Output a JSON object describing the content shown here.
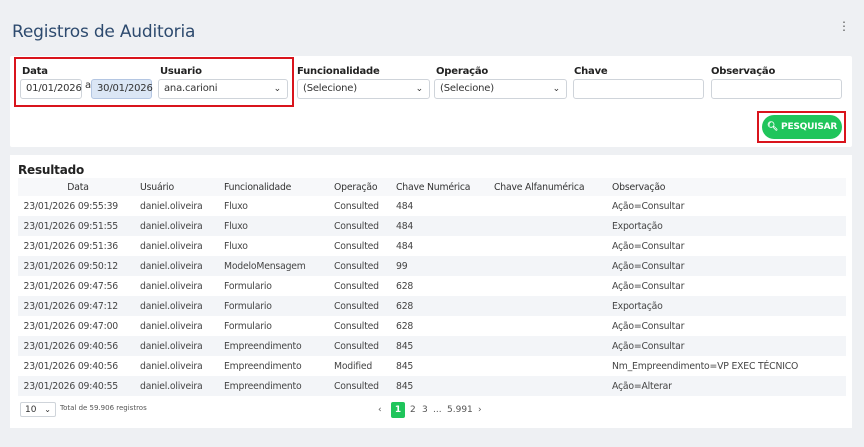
{
  "page": {
    "title": "Registros de Auditoria",
    "menu_icon": "kebab-icon"
  },
  "filters": {
    "date_label": "Data",
    "date_from": "01/01/2026",
    "date_sep": "a",
    "date_to": "30/01/2026",
    "user_label": "Usuario",
    "user_value": "ana.carioni",
    "func_label": "Funcionalidade",
    "func_value": "(Selecione)",
    "op_label": "Operação",
    "op_value": "(Selecione)",
    "key_label": "Chave",
    "key_value": "",
    "obs_label": "Observação",
    "obs_value": "",
    "search_label": "PESQUISAR"
  },
  "results": {
    "title": "Resultado",
    "columns": [
      "Data",
      "Usuário",
      "Funcionalidade",
      "Operação",
      "Chave Numérica",
      "Chave Alfanumérica",
      "Observação"
    ],
    "rows": [
      [
        "23/01/2026 09:55:39",
        "daniel.oliveira",
        "Fluxo",
        "Consulted",
        "484",
        "",
        "Ação=Consultar"
      ],
      [
        "23/01/2026 09:51:55",
        "daniel.oliveira",
        "Fluxo",
        "Consulted",
        "484",
        "",
        "Exportação"
      ],
      [
        "23/01/2026 09:51:36",
        "daniel.oliveira",
        "Fluxo",
        "Consulted",
        "484",
        "",
        "Ação=Consultar"
      ],
      [
        "23/01/2026 09:50:12",
        "daniel.oliveira",
        "ModeloMensagem",
        "Consulted",
        "99",
        "",
        "Ação=Consultar"
      ],
      [
        "23/01/2026 09:47:56",
        "daniel.oliveira",
        "Formulario",
        "Consulted",
        "628",
        "",
        "Ação=Consultar"
      ],
      [
        "23/01/2026 09:47:12",
        "daniel.oliveira",
        "Formulario",
        "Consulted",
        "628",
        "",
        "Exportação"
      ],
      [
        "23/01/2026 09:47:00",
        "daniel.oliveira",
        "Formulario",
        "Consulted",
        "628",
        "",
        "Ação=Consultar"
      ],
      [
        "23/01/2026 09:40:56",
        "daniel.oliveira",
        "Empreendimento",
        "Consulted",
        "845",
        "",
        "Ação=Consultar"
      ],
      [
        "23/01/2026 09:40:56",
        "daniel.oliveira",
        "Empreendimento",
        "Modified",
        "845",
        "",
        "Nm_Empreendimento=VP EXEC TÉCNICO"
      ],
      [
        "23/01/2026 09:40:55",
        "daniel.oliveira",
        "Empreendimento",
        "Consulted",
        "845",
        "",
        "Ação=Alterar"
      ]
    ]
  },
  "footer": {
    "page_size": "10",
    "total_text": "Total de 59.906 registros",
    "prev": "‹",
    "pages": [
      "1",
      "2",
      "3",
      "...",
      "5.991"
    ],
    "next": "›"
  },
  "colors": {
    "accent_green": "#1fc55b",
    "title_blue": "#2d4a6e",
    "highlight_red": "#d9141c"
  }
}
